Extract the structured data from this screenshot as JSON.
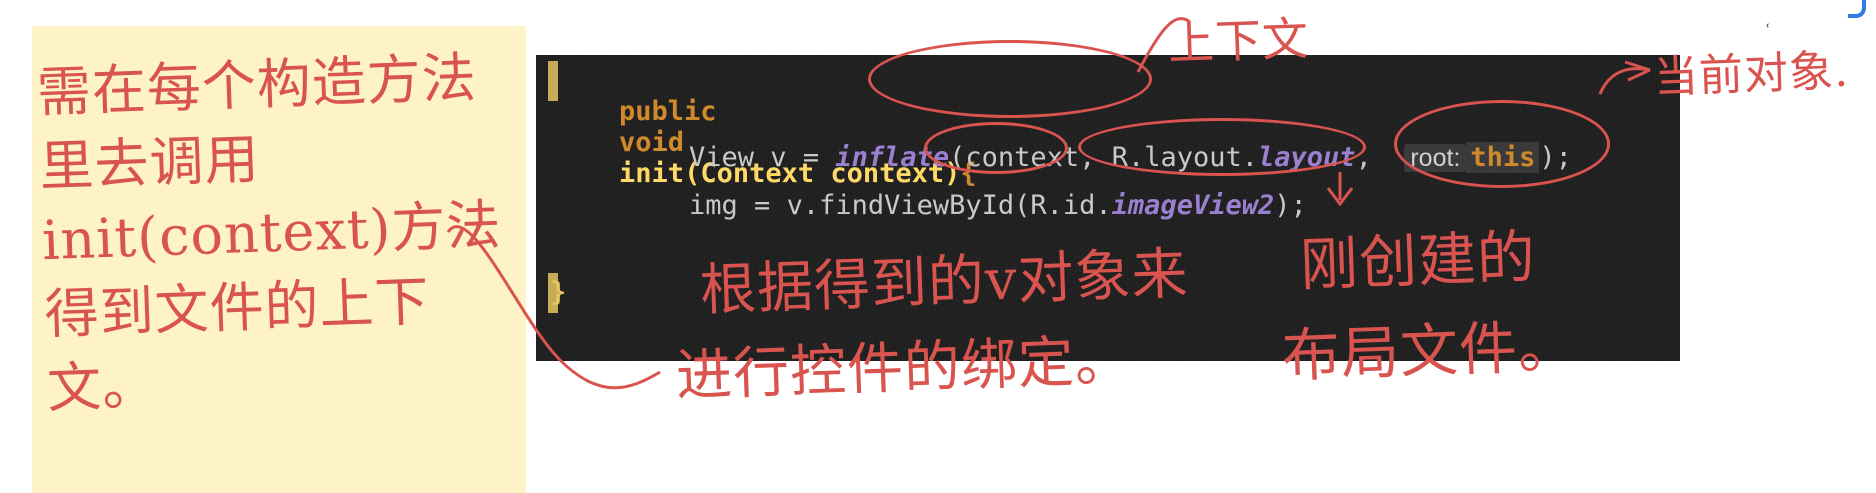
{
  "sticky_note": {
    "text": "需在每个构造方法里去调用init(context)方法得到文件的上下文。"
  },
  "code": {
    "line1": {
      "kw_public": "public",
      "kw_void": "void",
      "method": "init",
      "params": "(Context context)",
      "brace": "{"
    },
    "line2": {
      "lhs": "View v = ",
      "call": "inflate",
      "arg1": "(context,",
      "arg2": "R.layout.",
      "arg2_it": "layout",
      "comma": ",",
      "hint_label": "root:",
      "this_kw": "this",
      "end": ");"
    },
    "line3": {
      "lhs": "img = v.findViewById(R.id.",
      "arg_it": "imageView2",
      "end": ");"
    },
    "close_brace": "}"
  },
  "annotations": {
    "context_note": "上下文",
    "this_note": "当前对象.",
    "bind_note_1": "根据得到的v对象来",
    "bind_note_2": "进行控件的绑定。",
    "layout_note_1": "刚创建的",
    "layout_note_2": "布局文件。"
  },
  "colors": {
    "ink": "#d9534f",
    "editor_bg": "#202020",
    "note_bg": "#fdf3c6",
    "keyword": "#d08a2c",
    "italic_purple": "#9b7fd0"
  }
}
